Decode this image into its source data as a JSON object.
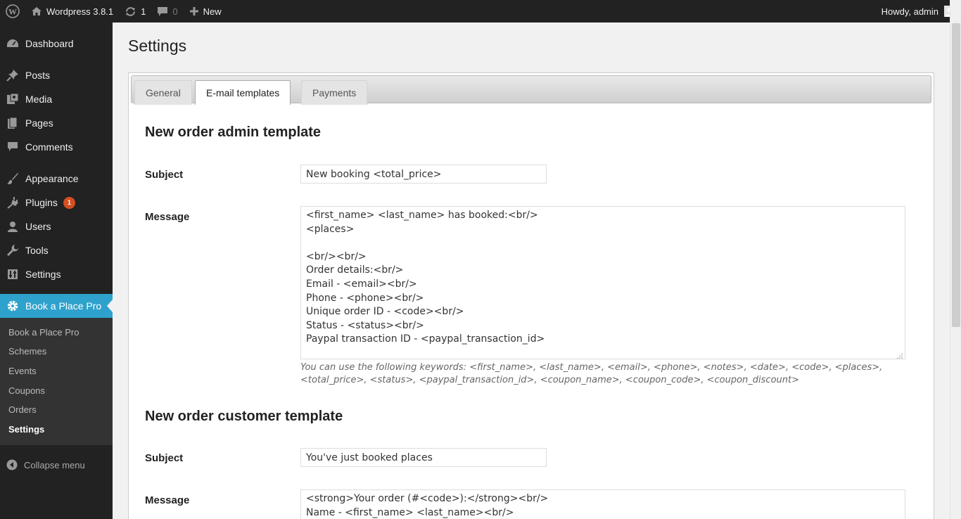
{
  "adminbar": {
    "site_name": "Wordpress 3.8.1",
    "updates_count": "1",
    "comments_count": "0",
    "new_label": "New",
    "howdy": "Howdy, admin"
  },
  "menu": {
    "items": [
      {
        "label": "Dashboard"
      },
      {
        "label": "Posts"
      },
      {
        "label": "Media"
      },
      {
        "label": "Pages"
      },
      {
        "label": "Comments"
      },
      {
        "label": "Appearance"
      },
      {
        "label": "Plugins",
        "badge": "1"
      },
      {
        "label": "Users"
      },
      {
        "label": "Tools"
      },
      {
        "label": "Settings"
      },
      {
        "label": "Book a Place Pro"
      }
    ],
    "submenu": [
      "Book a Place Pro",
      "Schemes",
      "Events",
      "Coupons",
      "Orders",
      "Settings"
    ],
    "collapse": "Collapse menu"
  },
  "page": {
    "title": "Settings",
    "tabs": [
      "General",
      "E-mail templates",
      "Payments"
    ],
    "admin_template": {
      "title": "New order admin template",
      "subject_label": "Subject",
      "subject_value": "New booking <total_price>",
      "message_label": "Message",
      "message_lines": [
        "<first_name> <last_name> has booked:<br/>",
        "<places>",
        "",
        "<br/><br/>",
        "Order details:<br/>",
        "Email - <email><br/>",
        "Phone - <phone><br/>",
        "Unique order ID - <code><br/>",
        "Status - <status><br/>",
        "Paypal transaction ID - <paypal_transaction_id>"
      ],
      "hint_line1": "You can use the following keywords: <first_name>, <last_name>, <email>, <phone>, <notes>, <date>, <code>, <places>,",
      "hint_line2": "<total_price>, <status>, <paypal_transaction_id>, <coupon_name>, <coupon_code>, <coupon_discount>"
    },
    "customer_template": {
      "title": "New order customer template",
      "subject_label": "Subject",
      "subject_value": "You've just booked places",
      "message_label": "Message",
      "message_lines": [
        "<strong>Your order (#<code>):</strong><br/>",
        "Name - <first_name> <last_name><br/>"
      ]
    }
  },
  "colors": {
    "adminbar_bg": "#222222",
    "menu_active": "#2ea2cc",
    "badge": "#d54e21"
  }
}
